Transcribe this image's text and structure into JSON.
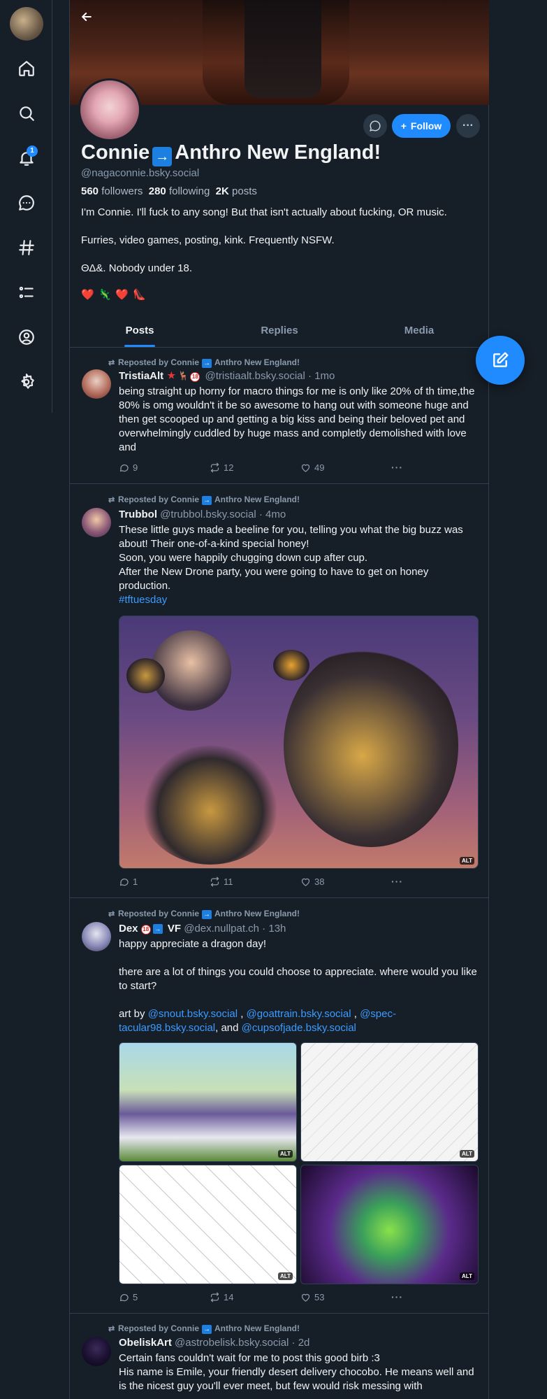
{
  "nav": {
    "notification_count": "1",
    "items": [
      "home-icon",
      "search-icon",
      "bell-icon",
      "chat-icon",
      "hashtag-icon",
      "list-icon",
      "profile-icon",
      "settings-icon"
    ]
  },
  "profile": {
    "display_name_prefix": "Connie",
    "arrow": "→",
    "display_name_suffix": "Anthro New England!",
    "handle": "@nagaconnie.bsky.social",
    "followers_count": "560",
    "followers_label": "followers",
    "following_count": "280",
    "following_label": "following",
    "posts_count": "2K",
    "posts_label": "posts",
    "bio": [
      "I'm Connie. I'll fuck to any song! But that isn't actually about fucking, OR music.",
      "Furries, video games, posting, kink. Frequently NSFW.",
      "ΘΔ&. Nobody under 18."
    ],
    "emoji_row": "❤️🦎❤️👠",
    "follow_label": "Follow"
  },
  "tabs": [
    {
      "label": "Posts",
      "active": true
    },
    {
      "label": "Replies",
      "active": false
    },
    {
      "label": "Media",
      "active": false
    }
  ],
  "repost_prefix": "Reposted by Connie",
  "repost_suffix": "Anthro New England!",
  "posts": [
    {
      "name": "TristiaAlt",
      "handle": "@tristiaalt.bsky.social",
      "time": "1mo",
      "text": "being straight up horny for macro things for me is only like 20% of th time,the 80% is omg wouldn't it be so awesome to hang out with someone huge and then get scooped up and getting a big kiss and being their beloved pet and overwhelmingly cuddled by huge mass and completly demolished with love and",
      "replies": "9",
      "reposts": "12",
      "likes": "49"
    },
    {
      "name": "Trubbol",
      "handle": "@trubbol.bsky.social",
      "time": "4mo",
      "text_lines": [
        "These little guys made a beeline for you, telling you what the big buzz was about! Their one-of-a-kind special honey!",
        "Soon, you were happily chugging down cup after cup.",
        "After the New Drone party, you were going to have to get on honey production."
      ],
      "hashtag": "#tftuesday",
      "alt": "ALT",
      "replies": "1",
      "reposts": "11",
      "likes": "38"
    },
    {
      "name": "Dex",
      "name2": "VF",
      "handle": "@dex.nullpat.ch",
      "time": "13h",
      "line1": "happy appreciate a dragon day!",
      "line2": "there are a lot of things you could choose to appreciate. where would you like to start?",
      "art_by": "art by",
      "links": [
        "@snout.bsky.social",
        "@goattrain.bsky.social",
        "@spec-tacular98.bsky.social",
        "@cupsofjade.bsky.social"
      ],
      "and": ", and",
      "alt": "ALT",
      "replies": "5",
      "reposts": "14",
      "likes": "53"
    },
    {
      "name": "ObeliskArt",
      "handle": "@astrobelisk.bsky.social",
      "time": "2d",
      "line1": "Certain fans couldn't wait for me to post this good birb :3",
      "line2": "His name is Emile, your friendly desert delivery chocobo. He means well and is the nicest guy you'll ever meet, but few would risk messing with"
    }
  ],
  "colors": {
    "background": "#161e27",
    "accent": "#208bfe",
    "muted": "#8a9aad",
    "border": "#2e4052"
  }
}
